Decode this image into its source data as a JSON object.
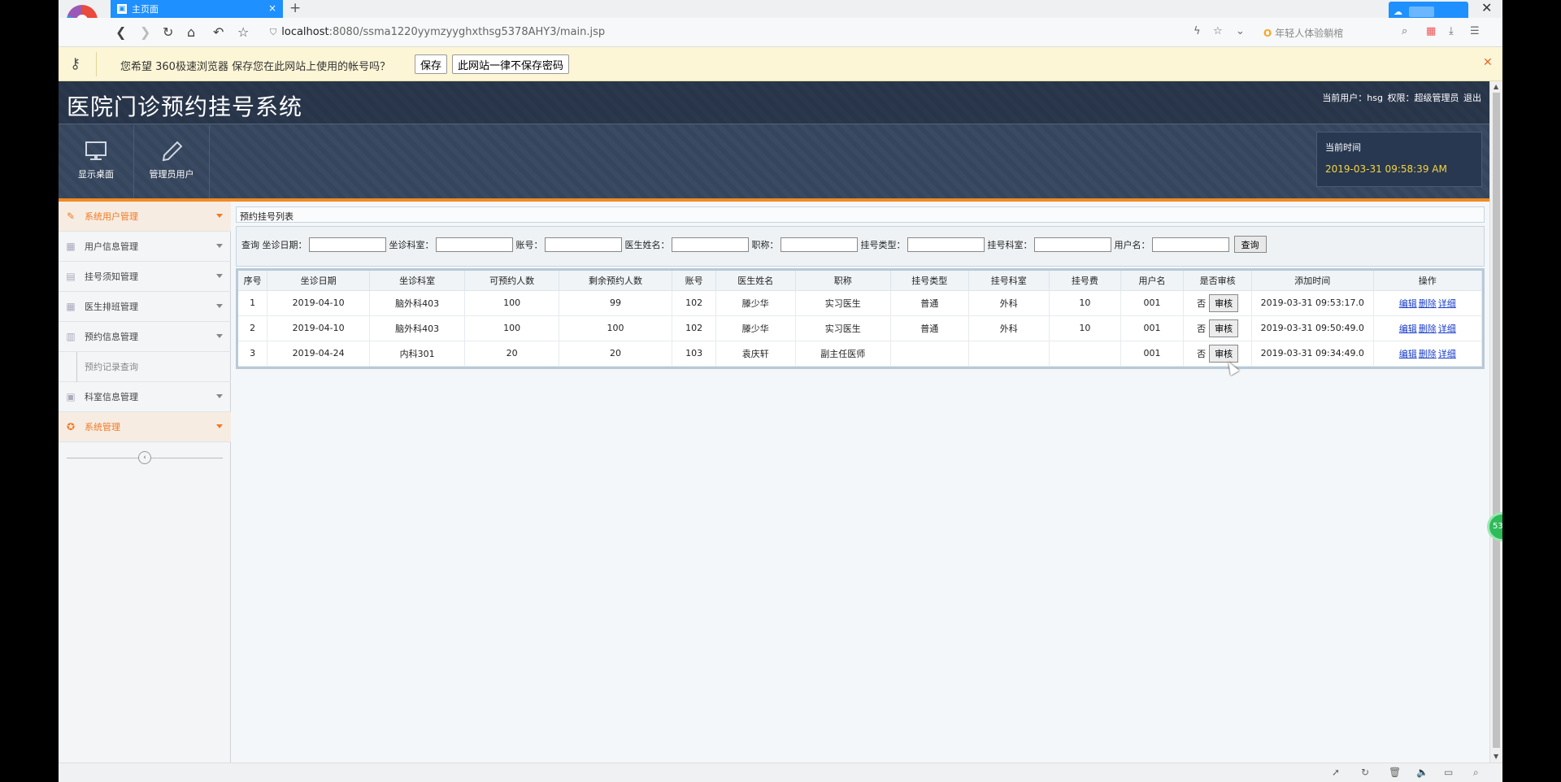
{
  "browser": {
    "tab_title": "主页面",
    "tab_close": "×",
    "new_tab": "+",
    "url_host": "localhost",
    "url_path": ":8080/ssma1220yymzyyghxthsg5378AHY3/main.jsp",
    "search_hint": "年轻人体验躺棺",
    "close_glyph": "✕",
    "nav_icons": [
      "back-icon",
      "forward-icon",
      "reload-icon",
      "home-icon",
      "undo-icon",
      "star-icon"
    ]
  },
  "password_bar": {
    "message": "您希望 360极速浏览器 保存您在此网站上使用的帐号吗？",
    "save_label": "保存",
    "never_label": "此网站一律不保存密码"
  },
  "app": {
    "title": "医院门诊预约挂号系统",
    "user_label": "当前用户：hsg",
    "role_label": "权限：超级管理员",
    "logout_label": "退出",
    "toolbar": [
      {
        "label": "显示桌面",
        "icon": "monitor-icon"
      },
      {
        "label": "管理员用户",
        "icon": "pencil-icon"
      }
    ],
    "time_label": "当前时间",
    "time_value": "2019-03-31 09:58:39 AM",
    "accent_color": "#f08a24"
  },
  "sidebar": {
    "items": [
      {
        "label": "系统用户管理",
        "active": true
      },
      {
        "label": "用户信息管理"
      },
      {
        "label": "挂号须知管理"
      },
      {
        "label": "医生排班管理"
      },
      {
        "label": "预约信息管理"
      },
      {
        "label": "预约记录查询",
        "sub": true
      },
      {
        "label": "科室信息管理"
      },
      {
        "label": "系统管理",
        "active": true
      }
    ]
  },
  "main": {
    "panel_title": "预约挂号列表",
    "search": {
      "prefix": "查询",
      "fields": [
        "坐诊日期：",
        "坐诊科室：",
        "账号：",
        "医生姓名：",
        "职称：",
        "挂号类型：",
        "挂号科室：",
        "用户名："
      ],
      "button": "查询"
    },
    "table": {
      "headers": [
        "序号",
        "坐诊日期",
        "坐诊科室",
        "可预约人数",
        "剩余预约人数",
        "账号",
        "医生姓名",
        "职称",
        "挂号类型",
        "挂号科室",
        "挂号费",
        "用户名",
        "是否审核",
        "添加时间",
        "操作"
      ],
      "audit_button": "审核",
      "actions": [
        "编辑",
        "删除",
        "详细"
      ],
      "rows": [
        [
          "1",
          "2019-04-10",
          "脑外科403",
          "100",
          "99",
          "102",
          "滕少华",
          "实习医生",
          "普通",
          "外科",
          "10",
          "001",
          "否",
          "2019-03-31 09:53:17.0"
        ],
        [
          "2",
          "2019-04-10",
          "脑外科403",
          "100",
          "100",
          "102",
          "滕少华",
          "实习医生",
          "普通",
          "外科",
          "10",
          "001",
          "否",
          "2019-03-31 09:50:49.0"
        ],
        [
          "3",
          "2019-04-24",
          "内科301",
          "20",
          "20",
          "103",
          "袁庆轩",
          "副主任医师",
          "",
          "",
          "",
          "001",
          "否",
          "2019-03-31 09:34:49.0"
        ]
      ]
    }
  },
  "float_ball_text": "53"
}
